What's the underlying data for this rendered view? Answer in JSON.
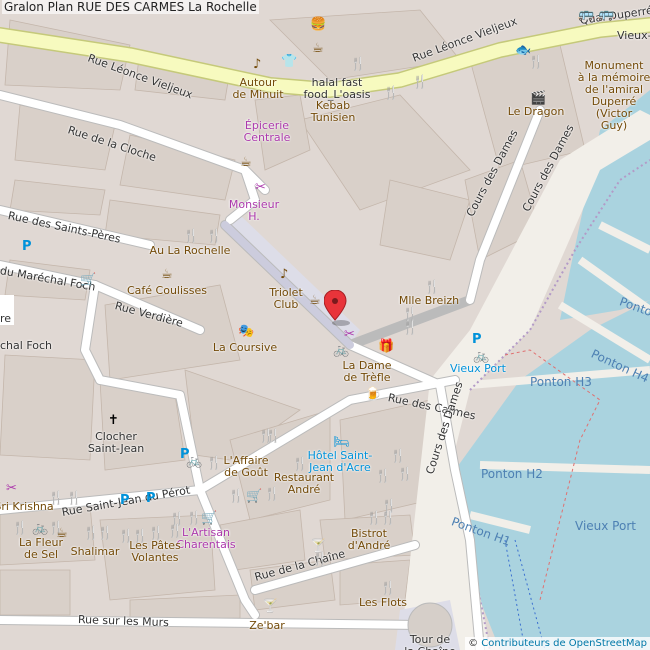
{
  "title": "Gralon Plan RUE DES CARMES La Rochelle",
  "attribution": {
    "symbol": "©",
    "link": "Contributeurs de OpenStreetMap"
  },
  "streets": [
    {
      "id": "leonce1",
      "text": "Rue Léonce Vieljeux"
    },
    {
      "id": "leonce2",
      "text": "Rue Léonce Vieljeux"
    },
    {
      "id": "quai",
      "text": "Quai Duperré"
    },
    {
      "id": "vieux",
      "text": "Vieux-"
    },
    {
      "id": "cloche",
      "text": "Rue de la Cloche"
    },
    {
      "id": "peres",
      "text": "Rue des Saints-Pères"
    },
    {
      "id": "foch1",
      "text": "du Maréchal Foch"
    },
    {
      "id": "foch2",
      "text": "chal Foch"
    },
    {
      "id": "verdiere",
      "text": "Rue Verdière"
    },
    {
      "id": "carmes",
      "text": "Rue des Carmes"
    },
    {
      "id": "dames1",
      "text": "Cours des Dames"
    },
    {
      "id": "dames2",
      "text": "Cours des Dames"
    },
    {
      "id": "dames3",
      "text": "Cours des Dames"
    },
    {
      "id": "perot",
      "text": "Rue Saint-Jean du Pérot"
    },
    {
      "id": "chaine",
      "text": "Rue de la Chaîne"
    },
    {
      "id": "murs",
      "text": "Rue sur les Murs"
    },
    {
      "id": "re",
      "text": "re"
    }
  ],
  "pois": [
    {
      "id": "autour",
      "lines": [
        "Autour",
        "de Minuit"
      ],
      "cls": "brown"
    },
    {
      "id": "halal",
      "lines": [
        "halal fast",
        "food_L'oasis"
      ],
      "cls": "dark"
    },
    {
      "id": "kebab",
      "lines": [
        "Kebab",
        "Tunisien"
      ],
      "cls": "brown"
    },
    {
      "id": "epicerie",
      "lines": [
        "Épicerie",
        "Centrale"
      ],
      "cls": "purple"
    },
    {
      "id": "monsieur",
      "lines": [
        "Monsieur",
        "H."
      ],
      "cls": "purple"
    },
    {
      "id": "rochelle",
      "lines": [
        "Au La Rochelle"
      ],
      "cls": "brown"
    },
    {
      "id": "cafe",
      "lines": [
        "Café Coulisses"
      ],
      "cls": "brown"
    },
    {
      "id": "triolet",
      "lines": [
        "Triolet",
        "Club"
      ],
      "cls": "brown"
    },
    {
      "id": "coursive",
      "lines": [
        "La Coursive"
      ],
      "cls": "brown"
    },
    {
      "id": "breizh",
      "lines": [
        "Mlle Breizh"
      ],
      "cls": "brown"
    },
    {
      "id": "dame",
      "lines": [
        "La Dame",
        "de Trèfle"
      ],
      "cls": "brown"
    },
    {
      "id": "vieuxport",
      "lines": [
        "Vieux Port"
      ],
      "cls": "blue"
    },
    {
      "id": "monument",
      "lines": [
        "Monument",
        "à la mémoire",
        "de l'amiral",
        "Duperré",
        "(Victor",
        "Guy)"
      ],
      "cls": "brown"
    },
    {
      "id": "dragon",
      "lines": [
        "Le Dragon"
      ],
      "cls": "brown"
    },
    {
      "id": "clocher",
      "lines": [
        "Clocher",
        "Saint-Jean"
      ],
      "cls": "dark"
    },
    {
      "id": "affaire",
      "lines": [
        "L'Affaire",
        "de Goût"
      ],
      "cls": "brown"
    },
    {
      "id": "hotel",
      "lines": [
        "Hôtel Saint-",
        "Jean d'Acre"
      ],
      "cls": "blue"
    },
    {
      "id": "andre",
      "lines": [
        "Restaurant",
        "André"
      ],
      "cls": "brown"
    },
    {
      "id": "bistrot",
      "lines": [
        "Bistrot",
        "d'André"
      ],
      "cls": "brown"
    },
    {
      "id": "flots",
      "lines": [
        "Les Flots"
      ],
      "cls": "brown"
    },
    {
      "id": "zebar",
      "lines": [
        "Ze'bar"
      ],
      "cls": "brown"
    },
    {
      "id": "tour",
      "lines": [
        "Tour de",
        "la Chaîne"
      ],
      "cls": "dark"
    },
    {
      "id": "artisan",
      "lines": [
        "L'Artisan",
        "Charentais"
      ],
      "cls": "purple"
    },
    {
      "id": "krishna",
      "lines": [
        "Sri Krishna"
      ],
      "cls": "brown"
    },
    {
      "id": "fleur",
      "lines": [
        "La Fleur",
        "de Sel"
      ],
      "cls": "brown"
    },
    {
      "id": "shalimar",
      "lines": [
        "Shalimar"
      ],
      "cls": "brown"
    },
    {
      "id": "petes",
      "lines": [
        "Les Pâtes",
        "Volantes"
      ],
      "cls": "brown"
    },
    {
      "id": "re2",
      "lines": [
        "re"
      ],
      "cls": "dark"
    }
  ],
  "water_labels": [
    {
      "id": "h3",
      "text": "Ponton H3"
    },
    {
      "id": "h2",
      "text": "Ponton H2"
    },
    {
      "id": "h1",
      "text": "Ponton H1"
    },
    {
      "id": "h4",
      "text": "Ponton H4"
    },
    {
      "id": "h5",
      "text": "Ponto"
    },
    {
      "id": "vp",
      "text": "Vieux Port"
    }
  ],
  "icons": {
    "restaurant": "🍴",
    "cafe": "☕",
    "fastfood": "🍔",
    "bar": "🍸",
    "pub": "🍺",
    "music": "♪",
    "hairdresser": "✂",
    "clothes": "👕",
    "gift": "🎁",
    "bicycle": "🚲",
    "parking": "P",
    "hotel": "🛏",
    "church": "✝",
    "theatre": "🎭",
    "cinema": "🎬",
    "bus": "🚌",
    "fish": "🐟",
    "shop": "🛒"
  },
  "colors": {
    "background": "#e0d8d3",
    "building": "#d9d0c9",
    "building_edge": "#c4b6ab",
    "road": "#ffffff",
    "road_edge": "#bbbbbb",
    "primary_road": "#f7fabf",
    "primary_edge": "#c5c97a",
    "water": "#aad3df",
    "pedestrian": "#dddde8",
    "pier": "#f2efe9",
    "pin": "#e8343a"
  }
}
